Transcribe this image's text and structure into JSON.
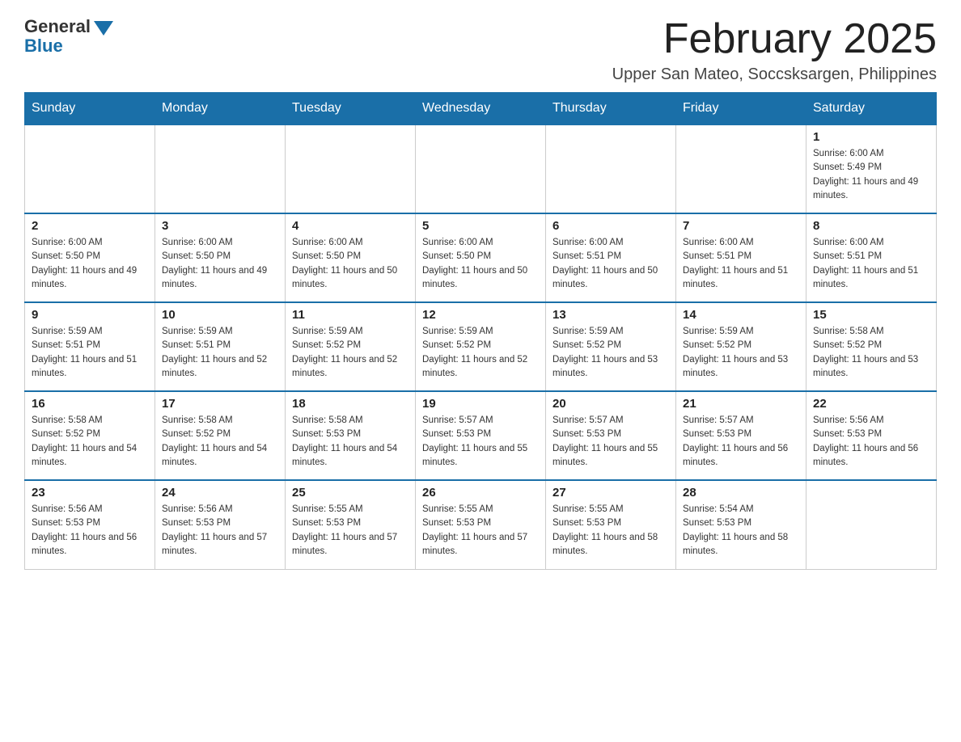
{
  "logo": {
    "general": "General",
    "blue": "Blue"
  },
  "header": {
    "month_year": "February 2025",
    "location": "Upper San Mateo, Soccsksargen, Philippines"
  },
  "days_of_week": [
    "Sunday",
    "Monday",
    "Tuesday",
    "Wednesday",
    "Thursday",
    "Friday",
    "Saturday"
  ],
  "weeks": [
    {
      "days": [
        {
          "num": "",
          "sunrise": "",
          "sunset": "",
          "daylight": "",
          "empty": true
        },
        {
          "num": "",
          "sunrise": "",
          "sunset": "",
          "daylight": "",
          "empty": true
        },
        {
          "num": "",
          "sunrise": "",
          "sunset": "",
          "daylight": "",
          "empty": true
        },
        {
          "num": "",
          "sunrise": "",
          "sunset": "",
          "daylight": "",
          "empty": true
        },
        {
          "num": "",
          "sunrise": "",
          "sunset": "",
          "daylight": "",
          "empty": true
        },
        {
          "num": "",
          "sunrise": "",
          "sunset": "",
          "daylight": "",
          "empty": true
        },
        {
          "num": "1",
          "sunrise": "Sunrise: 6:00 AM",
          "sunset": "Sunset: 5:49 PM",
          "daylight": "Daylight: 11 hours and 49 minutes.",
          "empty": false
        }
      ]
    },
    {
      "days": [
        {
          "num": "2",
          "sunrise": "Sunrise: 6:00 AM",
          "sunset": "Sunset: 5:50 PM",
          "daylight": "Daylight: 11 hours and 49 minutes.",
          "empty": false
        },
        {
          "num": "3",
          "sunrise": "Sunrise: 6:00 AM",
          "sunset": "Sunset: 5:50 PM",
          "daylight": "Daylight: 11 hours and 49 minutes.",
          "empty": false
        },
        {
          "num": "4",
          "sunrise": "Sunrise: 6:00 AM",
          "sunset": "Sunset: 5:50 PM",
          "daylight": "Daylight: 11 hours and 50 minutes.",
          "empty": false
        },
        {
          "num": "5",
          "sunrise": "Sunrise: 6:00 AM",
          "sunset": "Sunset: 5:50 PM",
          "daylight": "Daylight: 11 hours and 50 minutes.",
          "empty": false
        },
        {
          "num": "6",
          "sunrise": "Sunrise: 6:00 AM",
          "sunset": "Sunset: 5:51 PM",
          "daylight": "Daylight: 11 hours and 50 minutes.",
          "empty": false
        },
        {
          "num": "7",
          "sunrise": "Sunrise: 6:00 AM",
          "sunset": "Sunset: 5:51 PM",
          "daylight": "Daylight: 11 hours and 51 minutes.",
          "empty": false
        },
        {
          "num": "8",
          "sunrise": "Sunrise: 6:00 AM",
          "sunset": "Sunset: 5:51 PM",
          "daylight": "Daylight: 11 hours and 51 minutes.",
          "empty": false
        }
      ]
    },
    {
      "days": [
        {
          "num": "9",
          "sunrise": "Sunrise: 5:59 AM",
          "sunset": "Sunset: 5:51 PM",
          "daylight": "Daylight: 11 hours and 51 minutes.",
          "empty": false
        },
        {
          "num": "10",
          "sunrise": "Sunrise: 5:59 AM",
          "sunset": "Sunset: 5:51 PM",
          "daylight": "Daylight: 11 hours and 52 minutes.",
          "empty": false
        },
        {
          "num": "11",
          "sunrise": "Sunrise: 5:59 AM",
          "sunset": "Sunset: 5:52 PM",
          "daylight": "Daylight: 11 hours and 52 minutes.",
          "empty": false
        },
        {
          "num": "12",
          "sunrise": "Sunrise: 5:59 AM",
          "sunset": "Sunset: 5:52 PM",
          "daylight": "Daylight: 11 hours and 52 minutes.",
          "empty": false
        },
        {
          "num": "13",
          "sunrise": "Sunrise: 5:59 AM",
          "sunset": "Sunset: 5:52 PM",
          "daylight": "Daylight: 11 hours and 53 minutes.",
          "empty": false
        },
        {
          "num": "14",
          "sunrise": "Sunrise: 5:59 AM",
          "sunset": "Sunset: 5:52 PM",
          "daylight": "Daylight: 11 hours and 53 minutes.",
          "empty": false
        },
        {
          "num": "15",
          "sunrise": "Sunrise: 5:58 AM",
          "sunset": "Sunset: 5:52 PM",
          "daylight": "Daylight: 11 hours and 53 minutes.",
          "empty": false
        }
      ]
    },
    {
      "days": [
        {
          "num": "16",
          "sunrise": "Sunrise: 5:58 AM",
          "sunset": "Sunset: 5:52 PM",
          "daylight": "Daylight: 11 hours and 54 minutes.",
          "empty": false
        },
        {
          "num": "17",
          "sunrise": "Sunrise: 5:58 AM",
          "sunset": "Sunset: 5:52 PM",
          "daylight": "Daylight: 11 hours and 54 minutes.",
          "empty": false
        },
        {
          "num": "18",
          "sunrise": "Sunrise: 5:58 AM",
          "sunset": "Sunset: 5:53 PM",
          "daylight": "Daylight: 11 hours and 54 minutes.",
          "empty": false
        },
        {
          "num": "19",
          "sunrise": "Sunrise: 5:57 AM",
          "sunset": "Sunset: 5:53 PM",
          "daylight": "Daylight: 11 hours and 55 minutes.",
          "empty": false
        },
        {
          "num": "20",
          "sunrise": "Sunrise: 5:57 AM",
          "sunset": "Sunset: 5:53 PM",
          "daylight": "Daylight: 11 hours and 55 minutes.",
          "empty": false
        },
        {
          "num": "21",
          "sunrise": "Sunrise: 5:57 AM",
          "sunset": "Sunset: 5:53 PM",
          "daylight": "Daylight: 11 hours and 56 minutes.",
          "empty": false
        },
        {
          "num": "22",
          "sunrise": "Sunrise: 5:56 AM",
          "sunset": "Sunset: 5:53 PM",
          "daylight": "Daylight: 11 hours and 56 minutes.",
          "empty": false
        }
      ]
    },
    {
      "days": [
        {
          "num": "23",
          "sunrise": "Sunrise: 5:56 AM",
          "sunset": "Sunset: 5:53 PM",
          "daylight": "Daylight: 11 hours and 56 minutes.",
          "empty": false
        },
        {
          "num": "24",
          "sunrise": "Sunrise: 5:56 AM",
          "sunset": "Sunset: 5:53 PM",
          "daylight": "Daylight: 11 hours and 57 minutes.",
          "empty": false
        },
        {
          "num": "25",
          "sunrise": "Sunrise: 5:55 AM",
          "sunset": "Sunset: 5:53 PM",
          "daylight": "Daylight: 11 hours and 57 minutes.",
          "empty": false
        },
        {
          "num": "26",
          "sunrise": "Sunrise: 5:55 AM",
          "sunset": "Sunset: 5:53 PM",
          "daylight": "Daylight: 11 hours and 57 minutes.",
          "empty": false
        },
        {
          "num": "27",
          "sunrise": "Sunrise: 5:55 AM",
          "sunset": "Sunset: 5:53 PM",
          "daylight": "Daylight: 11 hours and 58 minutes.",
          "empty": false
        },
        {
          "num": "28",
          "sunrise": "Sunrise: 5:54 AM",
          "sunset": "Sunset: 5:53 PM",
          "daylight": "Daylight: 11 hours and 58 minutes.",
          "empty": false
        },
        {
          "num": "",
          "sunrise": "",
          "sunset": "",
          "daylight": "",
          "empty": true
        }
      ]
    }
  ]
}
